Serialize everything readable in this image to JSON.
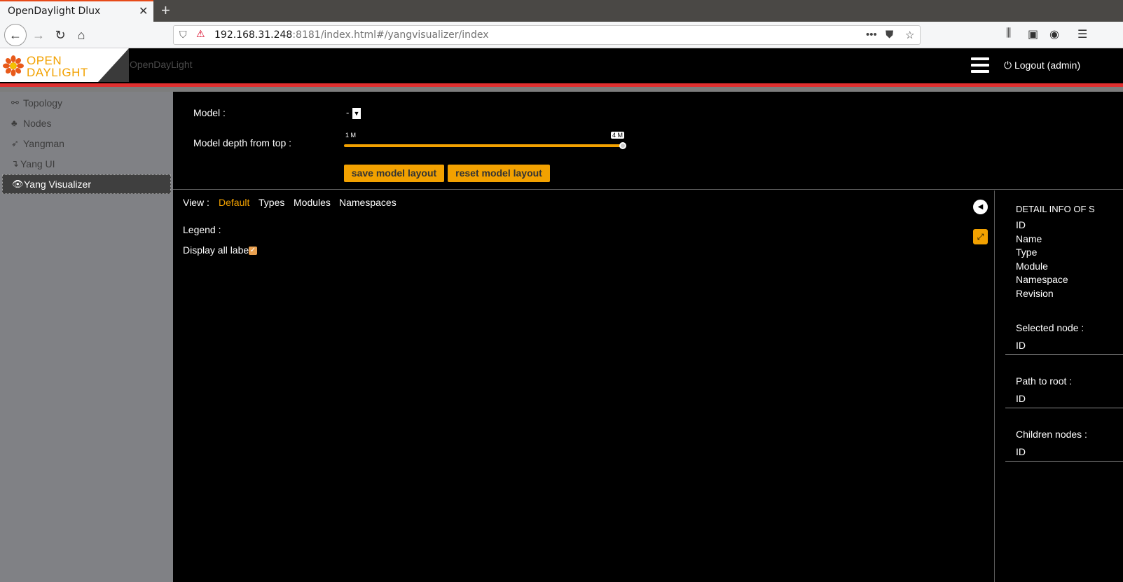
{
  "browser": {
    "tab_title": "OpenDaylight Dlux",
    "url_host": "192.168.31.248",
    "url_rest": ":8181/index.html#/yangvisualizer/index"
  },
  "header": {
    "logo_line1": "OPEN",
    "logo_line2": "DAYLIGHT",
    "brand_name": "OpenDayLight",
    "logout_label": "Logout (admin)"
  },
  "sidebar": {
    "items": [
      {
        "label": "Topology",
        "icon": "link-icon"
      },
      {
        "label": "Nodes",
        "icon": "sitemap-icon"
      },
      {
        "label": "Yangman",
        "icon": "rocket-icon"
      },
      {
        "label": "Yang UI",
        "icon": "level-down-icon"
      },
      {
        "label": "Yang Visualizer",
        "icon": "eye-icon",
        "active": true
      }
    ]
  },
  "controls": {
    "model_label": "Model :",
    "model_value": "-",
    "depth_label": "Model depth from top :",
    "slider_min_label": "1 M",
    "slider_max_label": "4 M",
    "save_label": "save model layout",
    "reset_label": "reset model layout"
  },
  "view": {
    "label": "View :",
    "tabs": [
      "Default",
      "Types",
      "Modules",
      "Namespaces"
    ],
    "active_tab": "Default",
    "legend_label": "Legend :",
    "display_all_labels": "Display all labels",
    "display_all_labels_checked": true
  },
  "detail": {
    "title": "DETAIL INFO OF S",
    "fields": [
      "ID",
      "Name",
      "Type",
      "Module",
      "Namespace",
      "Revision"
    ],
    "selected_node_label": "Selected node :",
    "selected_node_id": "ID",
    "path_to_root_label": "Path to root :",
    "path_to_root_id": "ID",
    "children_nodes_label": "Children nodes :",
    "children_nodes_id": "ID"
  },
  "colors": {
    "accent": "#f2a100",
    "red_bar": "#e03030",
    "sidebar_bg": "#808185"
  }
}
